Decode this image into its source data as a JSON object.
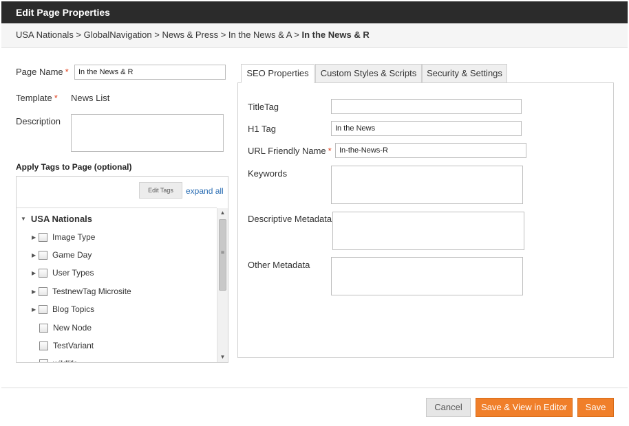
{
  "window": {
    "title": "Edit Page Properties"
  },
  "breadcrumb": {
    "path": "USA Nationals > GlobalNavigation > News & Press > In the News & A > ",
    "current": "In the News & R"
  },
  "page_form": {
    "page_name_label": "Page Name",
    "page_name_value": "In the News & R",
    "template_label": "Template",
    "template_value": "News List",
    "description_label": "Description",
    "description_value": "",
    "required_marker": "*"
  },
  "tags": {
    "title": "Apply Tags to Page (optional)",
    "edit_tags_label": "Edit Tags",
    "expand_all_label": "expand all",
    "root": "USA Nationals",
    "items": [
      {
        "label": "Image Type",
        "expandable": true,
        "checked": false
      },
      {
        "label": "Game Day",
        "expandable": true,
        "checked": false
      },
      {
        "label": "User Types",
        "expandable": true,
        "checked": false
      },
      {
        "label": "TestnewTag Microsite",
        "expandable": true,
        "checked": false
      },
      {
        "label": "Blog Topics",
        "expandable": true,
        "checked": false
      },
      {
        "label": "New Node",
        "expandable": false,
        "checked": false
      },
      {
        "label": "TestVariant",
        "expandable": false,
        "checked": false
      },
      {
        "label": "wildlife",
        "expandable": false,
        "checked": false
      }
    ]
  },
  "tabs": [
    {
      "label": "SEO Properties",
      "active": true
    },
    {
      "label": "Custom Styles & Scripts",
      "active": false
    },
    {
      "label": "Security & Settings",
      "active": false
    }
  ],
  "seo": {
    "title_tag_label": "TitleTag",
    "title_tag_value": "",
    "h1_tag_label": "H1 Tag",
    "h1_tag_value": "In the News",
    "url_friendly_label": "URL Friendly Name",
    "url_friendly_value": "In-the-News-R",
    "keywords_label": "Keywords",
    "keywords_value": "",
    "descriptive_metadata_label": "Descriptive Metadata",
    "descriptive_metadata_value": "",
    "other_metadata_label": "Other Metadata",
    "other_metadata_value": ""
  },
  "footer": {
    "cancel_label": "Cancel",
    "save_view_label": "Save & View in Editor",
    "save_label": "Save"
  },
  "colors": {
    "header_bg": "#2b2b2b",
    "accent": "#f07f2a",
    "required": "#e0401c",
    "link": "#2a6db3"
  }
}
